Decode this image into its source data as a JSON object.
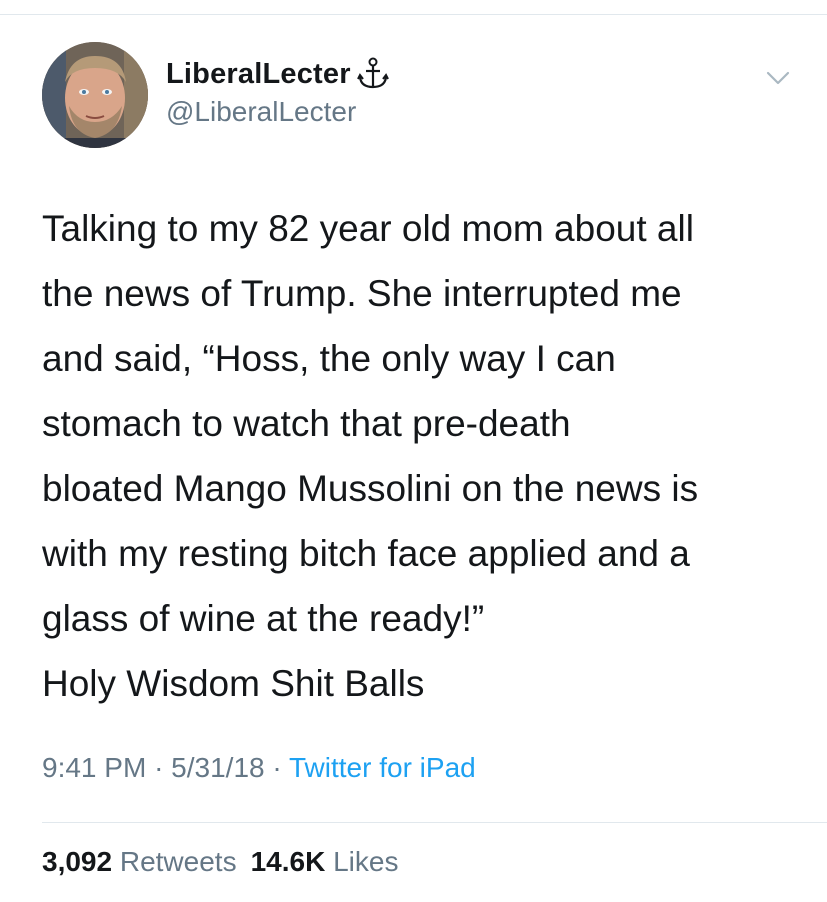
{
  "tweet": {
    "display_name": "LiberalLecter",
    "handle": "@LiberalLecter",
    "name_badge_icon": "anchor-icon",
    "menu_icon": "chevron-down-icon",
    "text": "Talking to my 82 year old mom about all\nthe news of Trump. She interrupted me\nand said, “Hoss, the only way I can\nstomach to watch that pre-death\nbloated Mango Mussolini on the news is\nwith my resting bitch face applied and a\nglass of wine at the ready!”\nHoly Wisdom Shit Balls",
    "time": "9:41 PM",
    "date": "5/31/18",
    "separator": "·",
    "source": "Twitter for iPad",
    "retweets_count": "3,092",
    "retweets_label": "Retweets",
    "likes_count": "14.6K",
    "likes_label": "Likes"
  },
  "colors": {
    "text_primary": "#14171a",
    "text_secondary": "#657786",
    "link": "#1da1f2",
    "divider": "#e1e8ed"
  }
}
